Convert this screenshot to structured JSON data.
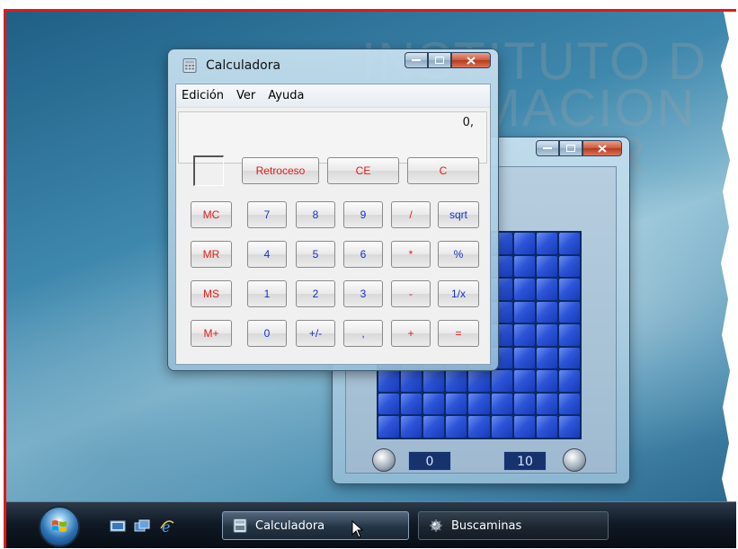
{
  "watermark": {
    "line1": "INSTITUTO D",
    "line2": "FORMACION",
    "line3": "SUPERIOR"
  },
  "calculator": {
    "title": "Calculadora",
    "menu": [
      "Edición",
      "Ver",
      "Ayuda"
    ],
    "display": "0,",
    "top_keys": [
      "Retroceso",
      "CE",
      "C"
    ],
    "memory_keys": [
      "MC",
      "MR",
      "MS",
      "M+"
    ],
    "keypad": [
      [
        "7",
        "8",
        "9",
        "/",
        "sqrt"
      ],
      [
        "4",
        "5",
        "6",
        "*",
        "%"
      ],
      [
        "1",
        "2",
        "3",
        "-",
        "1/x"
      ],
      [
        "0",
        "+/-",
        ",",
        "+",
        "="
      ]
    ]
  },
  "minesweeper": {
    "rows": 9,
    "cols": 9,
    "time_counter": "0",
    "mines_counter": "10"
  },
  "taskbar": {
    "quick_launch_icons": [
      "show-desktop-icon",
      "switch-windows-icon",
      "internet-explorer-icon"
    ],
    "items": [
      {
        "label": "Calculadora",
        "active": true,
        "icon": "calculator-icon"
      },
      {
        "label": "Buscaminas",
        "active": false,
        "icon": "minesweeper-icon"
      }
    ]
  },
  "colors": {
    "frame_border": "#e01818",
    "key_red": "#e21b1b",
    "key_blue": "#1530c8",
    "mine_tile": "#2d55d8"
  }
}
